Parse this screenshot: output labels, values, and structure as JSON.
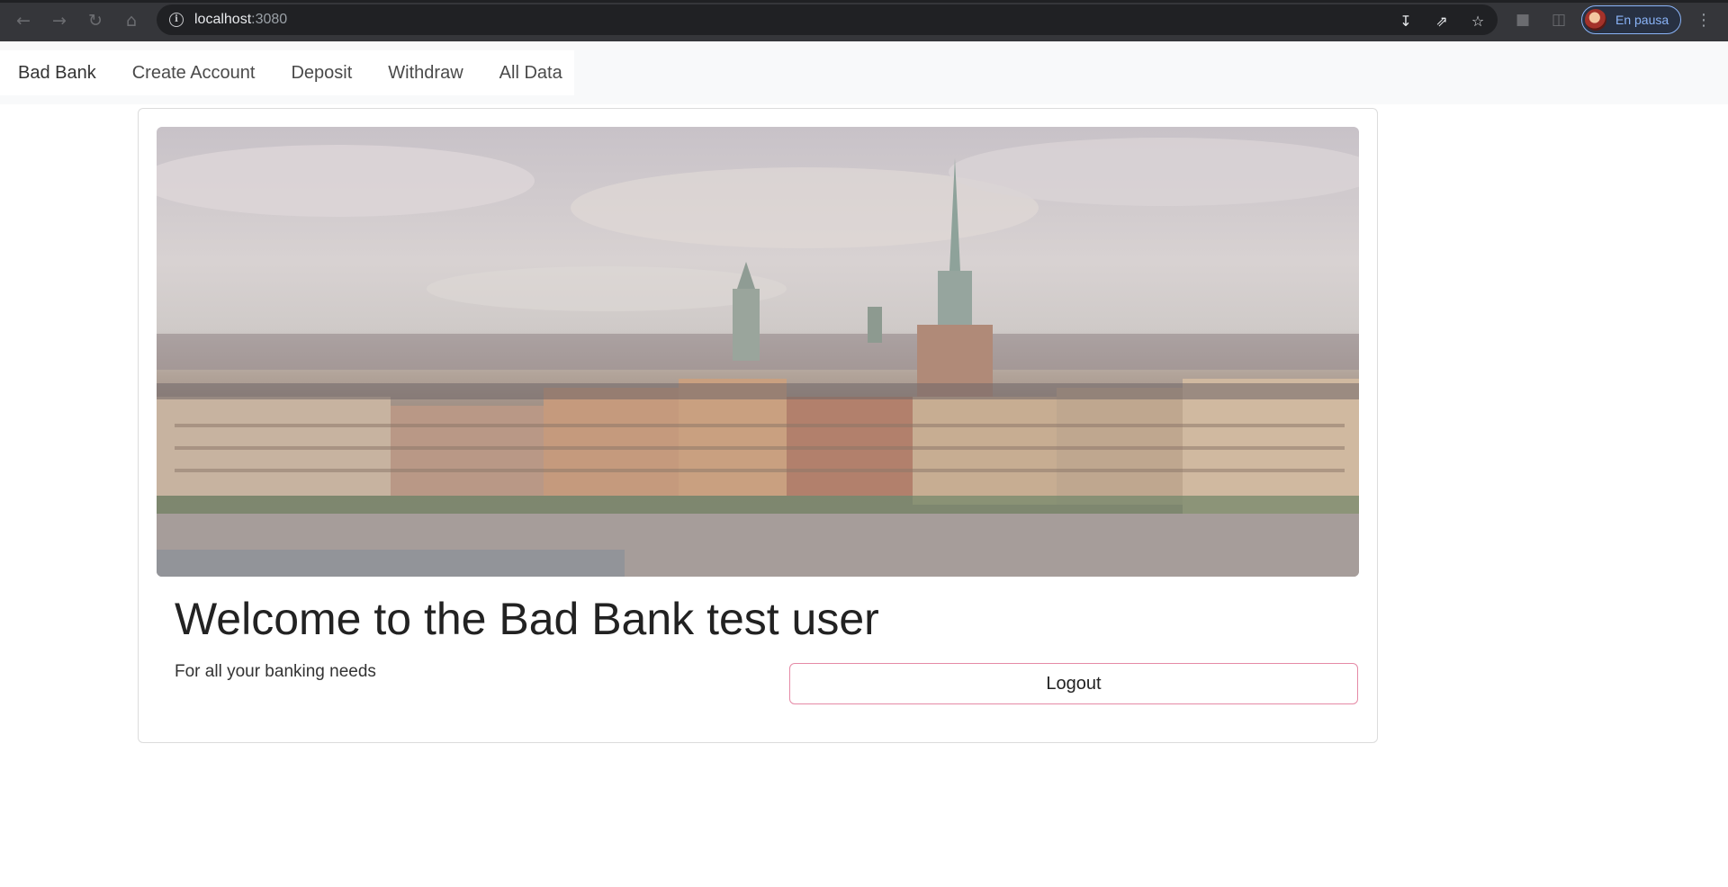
{
  "browser": {
    "url_host": "localhost",
    "url_port": ":3080",
    "profile_label": "En pausa",
    "icons": {
      "back": "arrow-left-icon",
      "forward": "arrow-right-icon",
      "reload": "reload-icon",
      "home": "home-icon",
      "site_info": "info-icon",
      "install": "install-icon",
      "share": "share-icon",
      "bookmark": "star-icon",
      "extensions": "puzzle-icon",
      "side_panel": "side-panel-icon",
      "menu": "kebab-menu-icon"
    }
  },
  "navbar": {
    "brand": "Bad Bank",
    "links": [
      "Create Account",
      "Deposit",
      "Withdraw",
      "All Data"
    ]
  },
  "card": {
    "title": "Welcome to the Bad Bank test user",
    "subtitle": "For all your banking needs",
    "logout_label": "Logout"
  },
  "colors": {
    "button_border": "#e58aa6",
    "navbar_bg": "#f8f9fa",
    "chrome_bg": "#35363a"
  }
}
